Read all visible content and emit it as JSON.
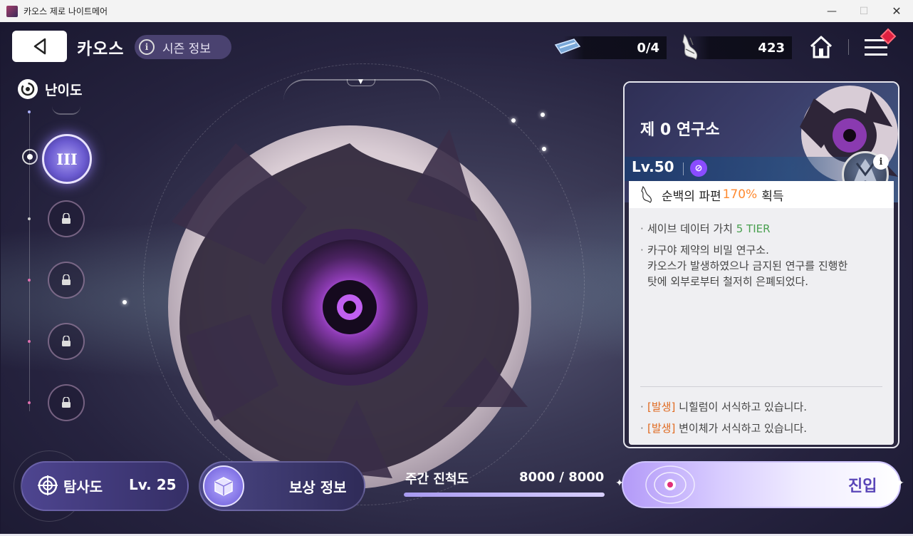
{
  "window": {
    "title": "카오스 제로 나이트메어",
    "minimize_glyph": "—",
    "maximize_glyph": "☐",
    "close_glyph": "✕"
  },
  "header": {
    "title": "카오스",
    "season_info_label": "시즌 정보",
    "tickets": "0/4",
    "currency": "423"
  },
  "difficulty": {
    "label": "난이도",
    "selected_numeral": "III"
  },
  "stage": {
    "name": "제 0 연구소",
    "level": "Lv.50",
    "reward_prefix": "순백의 파편",
    "reward_percent": "170%",
    "reward_suffix": "획득",
    "save_value_prefix": "세이브 데이터 가치",
    "save_value_tier": "5 TIER",
    "description": "카구야 제약의 비밀 연구소.\n카오스가 발생하였으나 금지된 연구를 진행한\n탓에 외부로부터 철저히 은폐되었다.",
    "events": [
      {
        "tag": "[발생]",
        "text": "니힐럼이 서식하고 있습니다."
      },
      {
        "tag": "[발생]",
        "text": "변이체가 서식하고 있습니다."
      }
    ]
  },
  "bottom": {
    "explore_label": "탐사도",
    "explore_level": "Lv. 25",
    "reward_info_label": "보상 정보",
    "weekly_progress_label": "주간 진척도",
    "weekly_progress_value": "8000 / 8000",
    "weekly_progress_fraction": 1.0,
    "enter_label": "진입"
  },
  "colors": {
    "accent": "#6b5bd0",
    "highlight_orange": "#ff8a30",
    "tier_green": "#4aa050",
    "event_orange": "#e06a20"
  },
  "icons": {
    "back": "back-arrow-icon",
    "info": "info-icon",
    "ticket": "ticket-icon",
    "shard": "white-shard-icon",
    "home": "home-icon",
    "menu": "menu-icon",
    "difficulty": "vortex-icon",
    "lock": "lock-icon",
    "compass": "compass-icon",
    "cube": "cube-icon",
    "enter": "target-icon"
  }
}
